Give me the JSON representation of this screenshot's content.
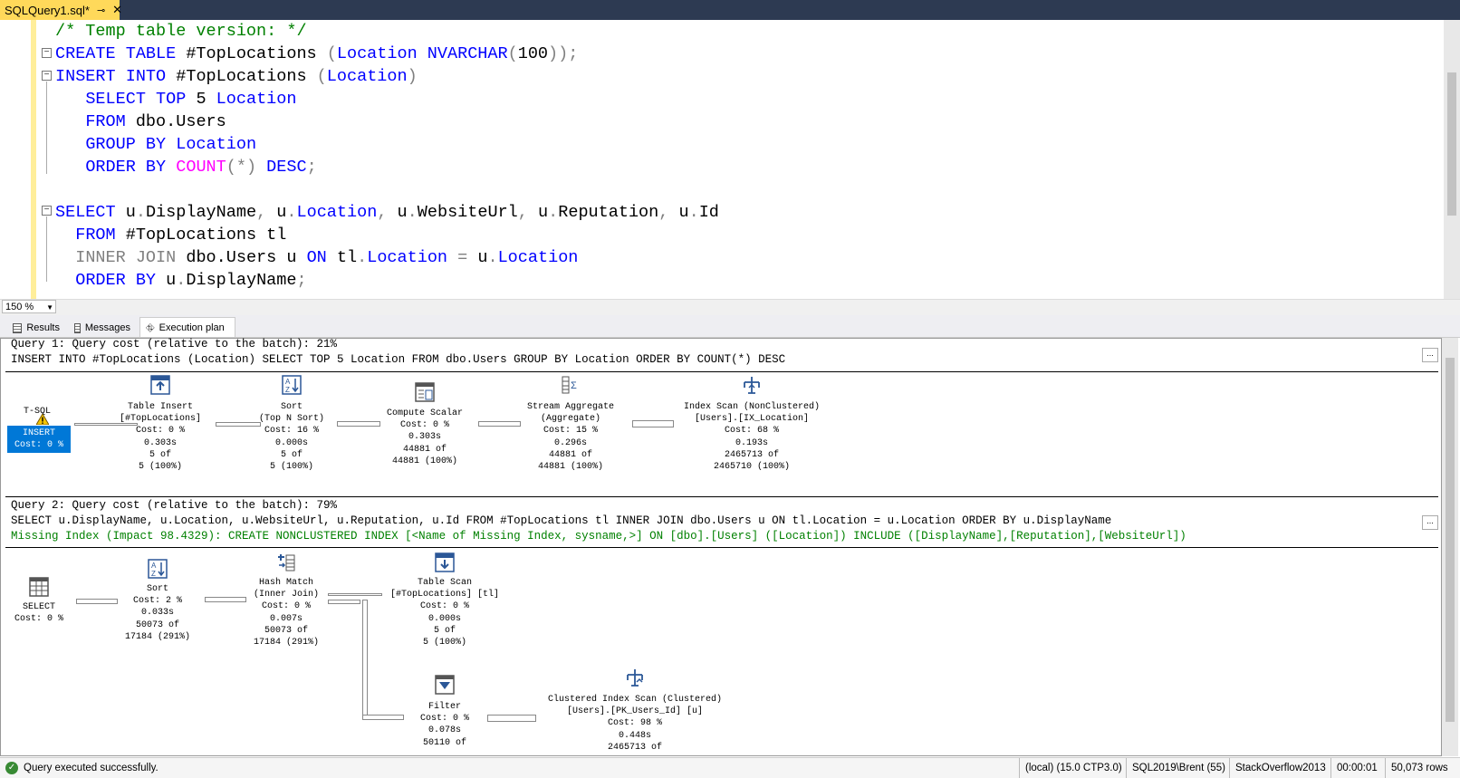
{
  "window": {
    "tab_title": "SQLQuery1.sql*",
    "pin_glyph": "⊸",
    "close_glyph": "✕"
  },
  "editor": {
    "zoom": "150 %",
    "lines": [
      {
        "parts": [
          {
            "c": "cm",
            "t": "/* Temp table version: */"
          }
        ]
      },
      {
        "parts": [
          {
            "c": "kw",
            "t": "CREATE TABLE "
          },
          {
            "c": "tx",
            "t": "#TopLocations "
          },
          {
            "c": "gr",
            "t": "("
          },
          {
            "c": "kw",
            "t": "Location NVARCHAR"
          },
          {
            "c": "gr",
            "t": "("
          },
          {
            "c": "tx",
            "t": "100"
          },
          {
            "c": "gr",
            "t": "));"
          }
        ]
      },
      {
        "parts": [
          {
            "c": "kw",
            "t": "INSERT INTO "
          },
          {
            "c": "tx",
            "t": "#TopLocations "
          },
          {
            "c": "gr",
            "t": "("
          },
          {
            "c": "kw",
            "t": "Location"
          },
          {
            "c": "gr",
            "t": ")"
          }
        ]
      },
      {
        "parts": [
          {
            "c": "tx",
            "t": "   "
          },
          {
            "c": "kw",
            "t": "SELECT TOP "
          },
          {
            "c": "tx",
            "t": "5 "
          },
          {
            "c": "kw",
            "t": "Location"
          }
        ]
      },
      {
        "parts": [
          {
            "c": "tx",
            "t": "   "
          },
          {
            "c": "kw",
            "t": "FROM "
          },
          {
            "c": "tx",
            "t": "dbo.Users"
          }
        ]
      },
      {
        "parts": [
          {
            "c": "tx",
            "t": "   "
          },
          {
            "c": "kw",
            "t": "GROUP BY Location"
          }
        ]
      },
      {
        "parts": [
          {
            "c": "tx",
            "t": "   "
          },
          {
            "c": "kw",
            "t": "ORDER BY "
          },
          {
            "c": "fn",
            "t": "COUNT"
          },
          {
            "c": "gr",
            "t": "(*) "
          },
          {
            "c": "kw",
            "t": "DESC"
          },
          {
            "c": "gr",
            "t": ";"
          }
        ]
      },
      {
        "parts": [
          {
            "c": "tx",
            "t": ""
          }
        ]
      },
      {
        "parts": [
          {
            "c": "kw",
            "t": "SELECT "
          },
          {
            "c": "tx",
            "t": "u"
          },
          {
            "c": "gr",
            "t": "."
          },
          {
            "c": "tx",
            "t": "DisplayName"
          },
          {
            "c": "gr",
            "t": ", "
          },
          {
            "c": "tx",
            "t": "u"
          },
          {
            "c": "gr",
            "t": "."
          },
          {
            "c": "kw",
            "t": "Location"
          },
          {
            "c": "gr",
            "t": ", "
          },
          {
            "c": "tx",
            "t": "u"
          },
          {
            "c": "gr",
            "t": "."
          },
          {
            "c": "tx",
            "t": "WebsiteUrl"
          },
          {
            "c": "gr",
            "t": ", "
          },
          {
            "c": "tx",
            "t": "u"
          },
          {
            "c": "gr",
            "t": "."
          },
          {
            "c": "tx",
            "t": "Reputation"
          },
          {
            "c": "gr",
            "t": ", "
          },
          {
            "c": "tx",
            "t": "u"
          },
          {
            "c": "gr",
            "t": "."
          },
          {
            "c": "tx",
            "t": "Id"
          }
        ]
      },
      {
        "parts": [
          {
            "c": "tx",
            "t": "  "
          },
          {
            "c": "kw",
            "t": "FROM "
          },
          {
            "c": "tx",
            "t": "#TopLocations tl"
          }
        ]
      },
      {
        "parts": [
          {
            "c": "tx",
            "t": "  "
          },
          {
            "c": "gr",
            "t": "INNER JOIN "
          },
          {
            "c": "tx",
            "t": "dbo.Users u "
          },
          {
            "c": "kw",
            "t": "ON "
          },
          {
            "c": "tx",
            "t": "tl"
          },
          {
            "c": "gr",
            "t": "."
          },
          {
            "c": "kw",
            "t": "Location "
          },
          {
            "c": "gr",
            "t": "= "
          },
          {
            "c": "tx",
            "t": "u"
          },
          {
            "c": "gr",
            "t": "."
          },
          {
            "c": "kw",
            "t": "Location"
          }
        ]
      },
      {
        "parts": [
          {
            "c": "tx",
            "t": "  "
          },
          {
            "c": "kw",
            "t": "ORDER BY "
          },
          {
            "c": "tx",
            "t": "u"
          },
          {
            "c": "gr",
            "t": "."
          },
          {
            "c": "tx",
            "t": "DisplayName"
          },
          {
            "c": "gr",
            "t": ";"
          }
        ]
      }
    ]
  },
  "result_tabs": {
    "results": "Results",
    "messages": "Messages",
    "plan": "Execution plan"
  },
  "plan": {
    "q1_header": "Query 1: Query cost (relative to the batch): 21%",
    "q1_sql": "INSERT INTO #TopLocations (Location) SELECT TOP 5 Location FROM dbo.Users GROUP BY Location ORDER BY COUNT(*) DESC",
    "q2_header": "Query 2: Query cost (relative to the batch): 79%",
    "q2_sql": "SELECT u.DisplayName, u.Location, u.WebsiteUrl, u.Reputation, u.Id FROM #TopLocations tl INNER JOIN dbo.Users u ON tl.Location = u.Location ORDER BY u.DisplayName",
    "q2_missing": "Missing Index (Impact 98.4329): CREATE NONCLUSTERED INDEX [<Name of Missing Index, sysname,>] ON [dbo].[Users] ([Location]) INCLUDE ([DisplayName],[Reputation],[WebsiteUrl])",
    "expand_glyph": "...",
    "q1_nodes": {
      "tsql_label": "T-SQL",
      "insert_label": "INSERT\nCost: 0 %",
      "table_insert": "Table Insert\n[#TopLocations]\nCost: 0 %\n0.303s\n5 of\n5 (100%)",
      "sort": "Sort\n(Top N Sort)\nCost: 16 %\n0.000s\n5 of\n5 (100%)",
      "compute_scalar": "Compute Scalar\nCost: 0 %\n0.303s\n44881 of\n44881 (100%)",
      "stream_aggregate": "Stream Aggregate\n(Aggregate)\nCost: 15 %\n0.296s\n44881 of\n44881 (100%)",
      "index_scan": "Index Scan (NonClustered)\n[Users].[IX_Location]\nCost: 68 %\n0.193s\n2465713 of\n2465710 (100%)"
    },
    "q2_nodes": {
      "select": "SELECT\nCost: 0 %",
      "sort": "Sort\nCost: 2 %\n0.033s\n50073 of\n17184 (291%)",
      "hash_match": "Hash Match\n(Inner Join)\nCost: 0 %\n0.007s\n50073 of\n17184 (291%)",
      "table_scan": "Table Scan\n[#TopLocations] [tl]\nCost: 0 %\n0.000s\n5 of\n5 (100%)",
      "filter": "Filter\nCost: 0 %\n0.078s\n50110 of",
      "clustered_scan": "Clustered Index Scan (Clustered)\n[Users].[PK_Users_Id] [u]\nCost: 98 %\n0.448s\n2465713 of"
    }
  },
  "status": {
    "message": "Query executed successfully.",
    "server": "(local) (15.0 CTP3.0)",
    "login": "SQL2019\\Brent (55)",
    "database": "StackOverflow2013",
    "elapsed": "00:00:01",
    "rows": "50,073 rows"
  },
  "colors": {
    "keyword": "#0000ff",
    "comment": "#008000",
    "function": "#ff00ff",
    "selected_node": "#0078d7",
    "tab_active": "#ffd95a"
  }
}
